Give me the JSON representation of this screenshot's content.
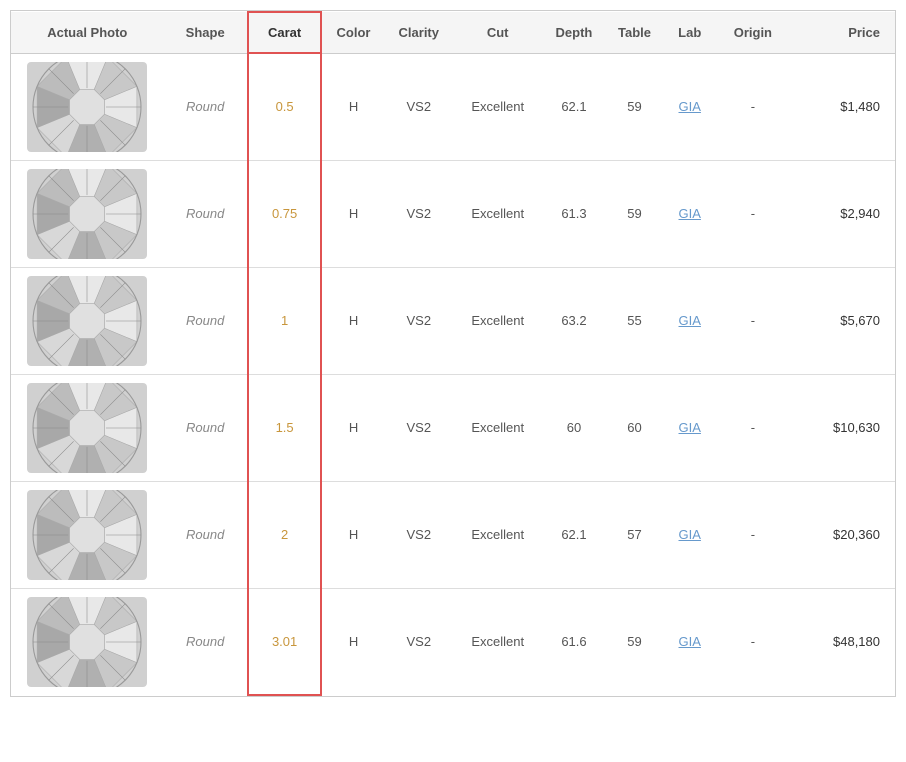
{
  "table": {
    "headers": {
      "actual_photo": "Actual Photo",
      "shape": "Shape",
      "carat": "Carat",
      "color": "Color",
      "clarity": "Clarity",
      "cut": "Cut",
      "depth": "Depth",
      "table": "Table",
      "lab": "Lab",
      "origin": "Origin",
      "price": "Price"
    },
    "rows": [
      {
        "shape": "Round",
        "carat": "0.5",
        "color": "H",
        "clarity": "VS2",
        "cut": "Excellent",
        "depth": "62.1",
        "table": "59",
        "lab": "GIA",
        "origin": "-",
        "price": "$1,480"
      },
      {
        "shape": "Round",
        "carat": "0.75",
        "color": "H",
        "clarity": "VS2",
        "cut": "Excellent",
        "depth": "61.3",
        "table": "59",
        "lab": "GIA",
        "origin": "-",
        "price": "$2,940"
      },
      {
        "shape": "Round",
        "carat": "1",
        "color": "H",
        "clarity": "VS2",
        "cut": "Excellent",
        "depth": "63.2",
        "table": "55",
        "lab": "GIA",
        "origin": "-",
        "price": "$5,670"
      },
      {
        "shape": "Round",
        "carat": "1.5",
        "color": "H",
        "clarity": "VS2",
        "cut": "Excellent",
        "depth": "60",
        "table": "60",
        "lab": "GIA",
        "origin": "-",
        "price": "$10,630"
      },
      {
        "shape": "Round",
        "carat": "2",
        "color": "H",
        "clarity": "VS2",
        "cut": "Excellent",
        "depth": "62.1",
        "table": "57",
        "lab": "GIA",
        "origin": "-",
        "price": "$20,360"
      },
      {
        "shape": "Round",
        "carat": "3.01",
        "color": "H",
        "clarity": "VS2",
        "cut": "Excellent",
        "depth": "61.6",
        "table": "59",
        "lab": "GIA",
        "origin": "-",
        "price": "$48,180"
      }
    ]
  }
}
